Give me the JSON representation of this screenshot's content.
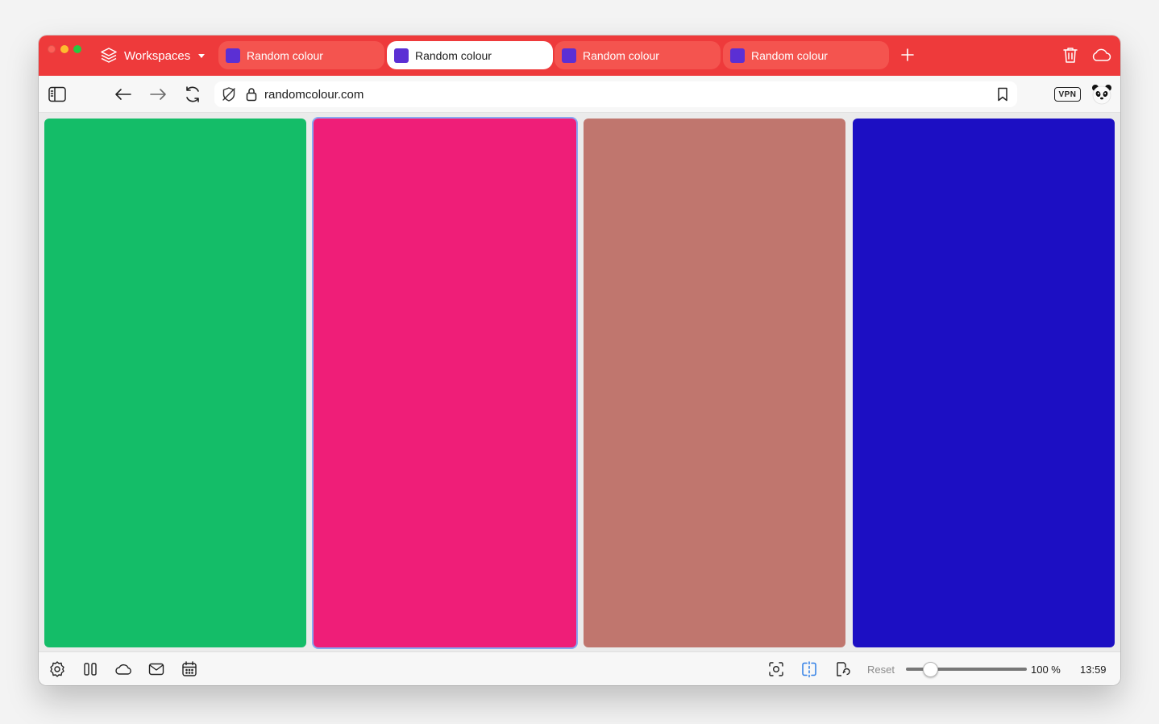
{
  "window": {
    "title": "Random colour"
  },
  "tabbar": {
    "workspaces_label": "Workspaces",
    "tabs": [
      {
        "label": "Random colour",
        "active": false
      },
      {
        "label": "Random colour",
        "active": true
      },
      {
        "label": "Random colour",
        "active": false
      },
      {
        "label": "Random colour",
        "active": false
      }
    ],
    "accent_color": "#ee3a3b",
    "favicon_color": "#5b2fd4"
  },
  "addressbar": {
    "url": "randomcolour.com",
    "vpn_label": "VPN"
  },
  "panes": [
    {
      "color": "#14bd68",
      "active": false
    },
    {
      "color": "#ef1e78",
      "active": true
    },
    {
      "color": "#c0766e",
      "active": false
    },
    {
      "color": "#1c0fc3",
      "active": false
    }
  ],
  "statusbar": {
    "reset_label": "Reset",
    "zoom_percent": 100,
    "zoom_label": "100 %",
    "clock": "13:59"
  }
}
